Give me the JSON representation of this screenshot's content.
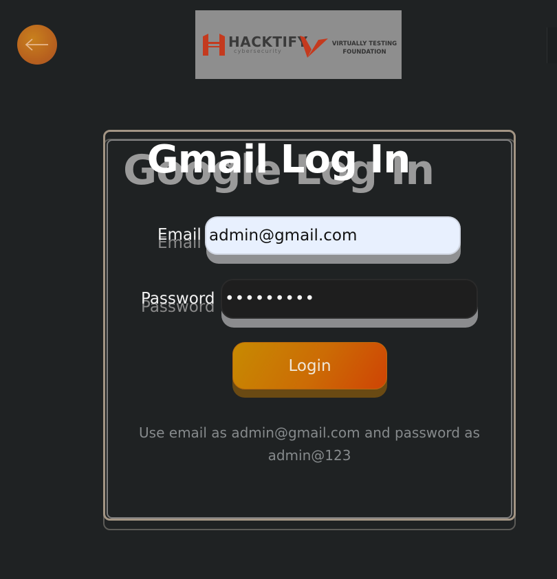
{
  "back_button": {
    "icon": "arrow-left-icon"
  },
  "logos": {
    "hacktify": {
      "title": "HACKTIFY",
      "subtitle": "cybersecurity"
    },
    "vtf": {
      "line1": "VIRTUALLY TESTING",
      "line2": "FOUNDATION"
    }
  },
  "login_card": {
    "title": "Gmail Log In",
    "title_shadow": "Google Log In",
    "email_label": "Email",
    "email_value": "admin@gmail.com",
    "password_label": "Password",
    "password_value": "•••••••••",
    "login_button": "Login",
    "hint": "Use email as admin@gmail.com and password as admin@123"
  },
  "colors": {
    "background": "#1f2223",
    "accent_orange": "#cc6b05",
    "card_border": "#a39584",
    "email_field_bg": "#e8f0fe"
  }
}
